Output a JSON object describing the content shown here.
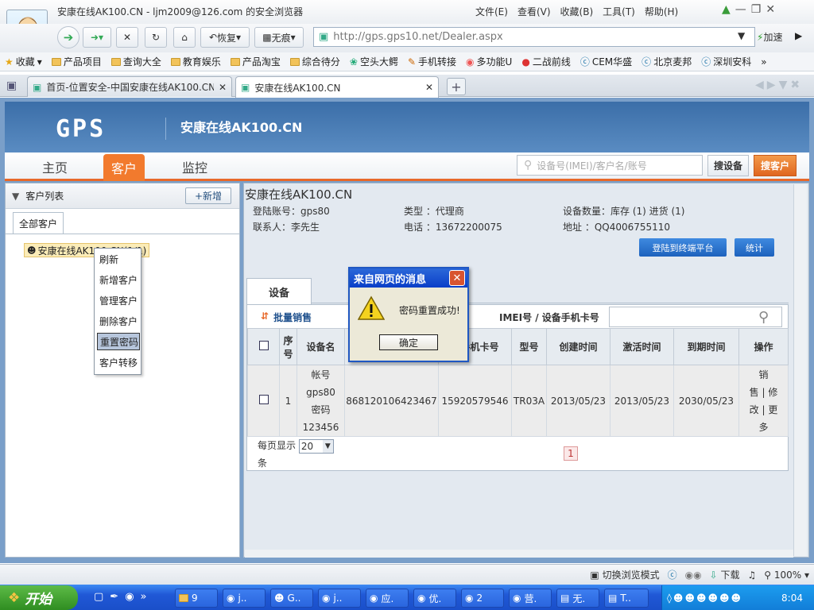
{
  "browser": {
    "window_title": "安康在线AK100.CN - ljm2009@126.com 的安全浏览器",
    "menu": [
      "文件(E)",
      "查看(V)",
      "收藏(B)",
      "工具(T)",
      "帮助(H)"
    ],
    "restore_label": "恢复",
    "notrace_label": "无痕",
    "url": "http://gps.gps10.net/Dealer.aspx",
    "accel_label": "加速",
    "favorites_label": "收藏",
    "favorites": [
      "产品项目",
      "查询大全",
      "教育娱乐",
      "产品淘宝",
      "综合待分",
      "空头大鳄",
      "手机转接",
      "多功能U",
      "二战前线",
      "CEM华盛",
      "北京麦邦",
      "深圳安科"
    ],
    "tabs": [
      {
        "label": "首页-位置安全-中国安康在线AK100.CN",
        "active": false
      },
      {
        "label": "安康在线AK100.CN",
        "active": true
      }
    ]
  },
  "site": {
    "logo": "GPS",
    "title": "安康在线AK100.CN",
    "nav": [
      "主页",
      "客户",
      "监控"
    ],
    "search_placeholder": "设备号(IMEI)/客户名/账号",
    "search_device_label": "搜设备",
    "search_customer_label": "搜客户"
  },
  "left_panel": {
    "heading": "客户列表",
    "add_label": "+新增",
    "all_tab": "全部客户",
    "tree_node": "安康在线AK100.CN(1/1)"
  },
  "context_menu": [
    "刷新",
    "新增客户",
    "管理客户",
    "删除客户",
    "重置密码",
    "客户转移"
  ],
  "customer": {
    "name": "安康在线AK100.CN",
    "login_account": "登陆账号：gps80",
    "contact": "联系人：李先生",
    "type": "类型 ：代理商",
    "phone": "电话 ：13672200075",
    "device_count": "设备数量：库存 (1) 进货 (1)",
    "address": "地址 ：QQ4006755110",
    "login_terminal_btn": "登陆到终端平台",
    "stats_btn": "统计"
  },
  "devices": {
    "tab": "设备",
    "batch_label": "批量销售",
    "imei_label": "IMEI号 / 设备手机卡号",
    "headers": [
      "序号",
      "设备名",
      "",
      "备手机卡号",
      "型号",
      "创建时间",
      "激活时间",
      "到期时间",
      "操作"
    ],
    "row": {
      "index": "1",
      "name_lines": [
        "帐号",
        "gps80",
        "密码",
        "123456"
      ],
      "imei": "868120106423467",
      "sim": "15920579546",
      "model": "TR03A",
      "created": "2013/05/23",
      "activated": "2013/05/23",
      "expires": "2030/05/23",
      "actions": [
        "销",
        "售 | 修",
        "改 | 更",
        "多"
      ]
    },
    "per_page_label": "每页显示",
    "per_page_suffix": "条",
    "per_page_value": "20",
    "page": "1"
  },
  "dialog": {
    "title": "来自网页的消息",
    "message": "密码重置成功!",
    "ok_label": "确定"
  },
  "statusbar": {
    "switch_mode": "切换浏览模式",
    "download": "下载",
    "zoom": "100%"
  },
  "taskbar": {
    "start": "开始",
    "items": [
      "9",
      "j..",
      "G..",
      "j..",
      "应.",
      "优.",
      "2",
      "营.",
      "无.",
      "T.."
    ],
    "clock": "8:04"
  }
}
